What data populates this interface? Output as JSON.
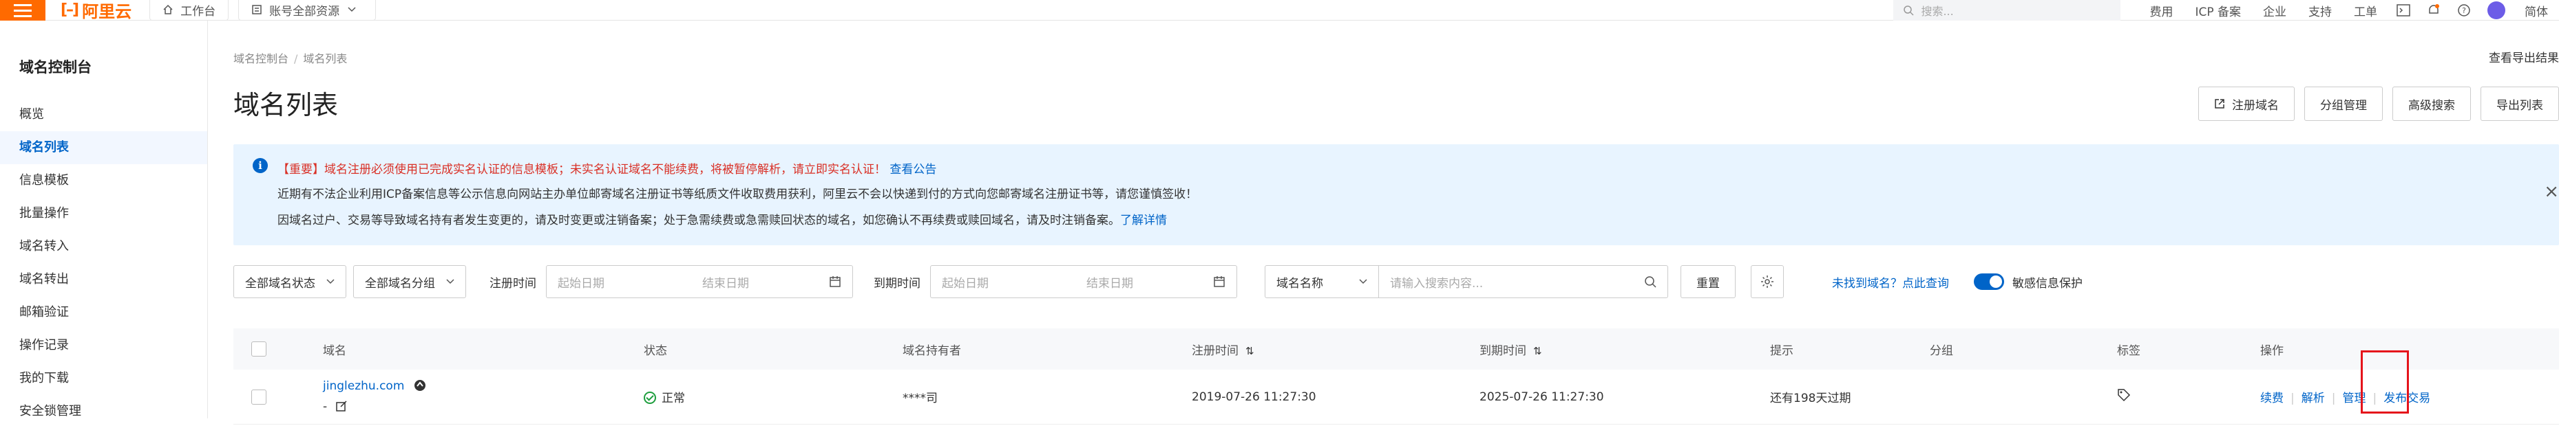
{
  "topbar": {
    "logo_text": "阿里云",
    "workbench": "工作台",
    "account_resources": "账号全部资源",
    "search_placeholder": "搜索...",
    "links": [
      "费用",
      "ICP 备案",
      "企业",
      "支持",
      "工单"
    ],
    "language": "简体",
    "brand_color": "#ff6a00"
  },
  "sidebar": {
    "title": "域名控制台",
    "items": [
      {
        "label": "概览",
        "active": false
      },
      {
        "label": "域名列表",
        "active": true
      },
      {
        "label": "信息模板",
        "active": false
      },
      {
        "label": "批量操作",
        "active": false
      },
      {
        "label": "域名转入",
        "active": false
      },
      {
        "label": "域名转出",
        "active": false
      },
      {
        "label": "邮箱验证",
        "active": false
      },
      {
        "label": "操作记录",
        "active": false
      },
      {
        "label": "我的下载",
        "active": false
      },
      {
        "label": "安全锁管理",
        "active": false
      }
    ]
  },
  "header": {
    "breadcrumb": [
      "域名控制台",
      "域名列表"
    ],
    "export_results": "查看导出结果",
    "title": "域名列表",
    "buttons": [
      "注册域名",
      "分组管理",
      "高级搜索",
      "导出列表"
    ]
  },
  "notice": {
    "line1_text": "【重要】域名注册必须使用已完成实名认证的信息模板；未实名认证域名不能续费，将被暂停解析，请立即实名认证！",
    "line1_link": "查看公告",
    "line2_text": "近期有不法企业利用ICP备案信息等公示信息向网站主办单位邮寄域名注册证书等纸质文件收取费用获利，阿里云不会以快递到付的方式向您邮寄域名注册证书等，请您谨慎签收！",
    "line3_text": "因域名过户、交易等导致域名持有者发生变更的，请及时变更或注销备案；处于急需续费或急需赎回状态的域名，如您确认不再续费或赎回域名，请及时注销备案。",
    "line3_link": "了解详情"
  },
  "filters": {
    "status": "全部域名状态",
    "group": "全部域名分组",
    "reg_time_label": "注册时间",
    "exp_time_label": "到期时间",
    "start_placeholder": "起始日期",
    "end_placeholder": "结束日期",
    "search_field": "域名名称",
    "search_placeholder": "请输入搜索内容...",
    "reset": "重置",
    "not_found_link": "未找到域名？点此查询",
    "privacy_toggle_label": "敏感信息保护",
    "privacy_toggle_on": true
  },
  "table": {
    "columns": [
      "域名",
      "状态",
      "域名持有者",
      "注册时间",
      "到期时间",
      "提示",
      "分组",
      "标签",
      "操作"
    ],
    "rows": [
      {
        "domain": "jinglezhu.com",
        "domain_sub": "-",
        "status": "正常",
        "holder": "****司",
        "reg_time": "2019-07-26 11:27:30",
        "exp_time": "2025-07-26 11:27:30",
        "hint": "还有198天过期",
        "group": "",
        "actions": [
          "续费",
          "解析",
          "管理",
          "发布交易"
        ]
      }
    ]
  },
  "annotation": {
    "highlight_color": "#e5141b"
  }
}
